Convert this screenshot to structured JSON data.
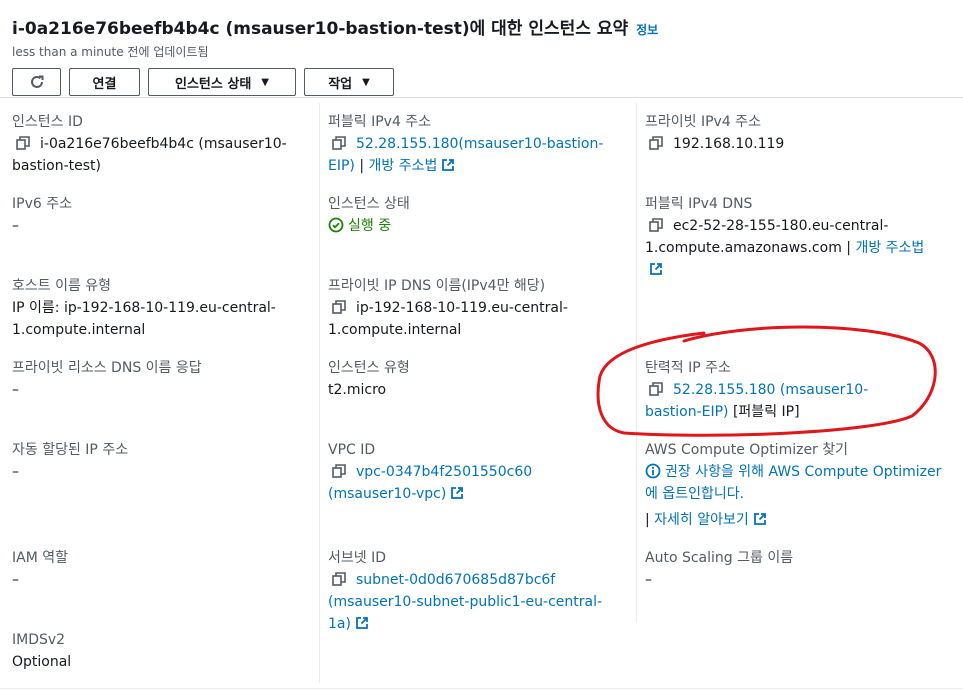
{
  "header": {
    "title": "i-0a216e76beefb4b4c (msauser10-bastion-test)에 대한 인스턴스 요약",
    "info_link": "정보",
    "updated": "less than a minute 전에 업데이트됨"
  },
  "toolbar": {
    "connect": "연결",
    "instance_state": "인스턴스 상태",
    "actions": "작업"
  },
  "details": {
    "instance_id": {
      "label": "인스턴스 ID",
      "value": "i-0a216e76beefb4b4c (msauser10-bastion-test)"
    },
    "public_ipv4": {
      "label": "퍼블릭 IPv4 주소",
      "value": "52.28.155.180(msauser10-bastion-EIP)",
      "pipe": "|",
      "open": "개방 주소법"
    },
    "private_ipv4": {
      "label": "프라이빗 IPv4 주소",
      "value": "192.168.10.119"
    },
    "ipv6": {
      "label": "IPv6 주소",
      "value": "–"
    },
    "instance_state": {
      "label": "인스턴스 상태",
      "value": "실행 중"
    },
    "public_dns": {
      "label": "퍼블릭 IPv4 DNS",
      "value": "ec2-52-28-155-180.eu-central-1.compute.amazonaws.com",
      "pipe": "|",
      "open": "개방 주소법"
    },
    "hostname_type": {
      "label": "호스트 이름 유형",
      "value": "IP 이름: ip-192-168-10-119.eu-central-1.compute.internal"
    },
    "private_dns": {
      "label": "프라이빗 IP DNS 이름(IPv4만 해당)",
      "value": "ip-192-168-10-119.eu-central-1.compute.internal"
    },
    "private_resource_dns": {
      "label": "프라이빗 리소스 DNS 이름 응답",
      "value": "–"
    },
    "instance_type": {
      "label": "인스턴스 유형",
      "value": "t2.micro"
    },
    "elastic_ip": {
      "label": "탄력적 IP 주소",
      "value": "52.28.155.180 (msauser10-bastion-EIP)",
      "suffix": "[퍼블릭 IP]"
    },
    "auto_assigned_ip": {
      "label": "자동 할당된 IP 주소",
      "value": "–"
    },
    "vpc_id": {
      "label": "VPC ID",
      "value": "vpc-0347b4f2501550c60 (msauser10-vpc)"
    },
    "optimizer": {
      "label": "AWS Compute Optimizer 찾기",
      "value": "권장 사항을 위해 AWS Compute Optimizer에 옵트인합니다.",
      "pipe": "|",
      "more": "자세히 알아보기"
    },
    "iam_role": {
      "label": "IAM 역할",
      "value": "–"
    },
    "subnet_id": {
      "label": "서브넷 ID",
      "value": "subnet-0d0d670685d87bc6f (msauser10-subnet-public1-eu-central-1a)"
    },
    "autoscaling": {
      "label": "Auto Scaling 그룹 이름",
      "value": "–"
    },
    "imdsv2": {
      "label": "IMDSv2",
      "value": "Optional"
    }
  },
  "colors": {
    "link": "#0073bb",
    "success": "#1d8102",
    "annotation": "#e0161b"
  }
}
